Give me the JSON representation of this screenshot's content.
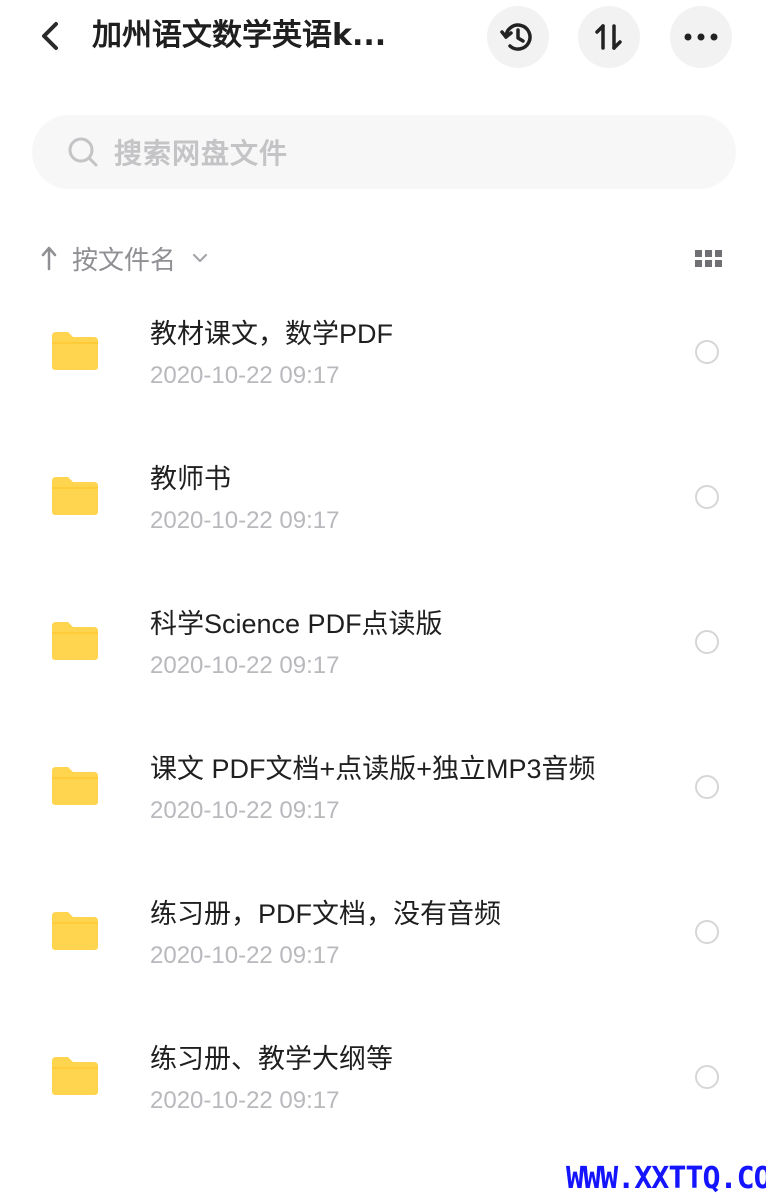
{
  "header": {
    "title": "加州语文数学英语k...",
    "back_icon": "chevron-left-icon",
    "history_icon": "history-icon",
    "sort_icon": "sort-arrows-icon",
    "more_icon": "more-dots-icon"
  },
  "search": {
    "placeholder": "搜索网盘文件",
    "icon": "search-icon"
  },
  "sort": {
    "label": "按文件名",
    "direction_icon": "arrow-up-icon",
    "dropdown_icon": "chevron-down-icon",
    "view_icon": "grid-view-icon"
  },
  "files": [
    {
      "name": "教材课文，数学PDF",
      "date": "2020-10-22  09:17",
      "icon": "folder-icon"
    },
    {
      "name": "教师书",
      "date": "2020-10-22  09:17",
      "icon": "folder-icon"
    },
    {
      "name": "科学Science PDF点读版",
      "date": "2020-10-22  09:17",
      "icon": "folder-icon"
    },
    {
      "name": "课文 PDF文档+点读版+独立MP3音频",
      "date": "2020-10-22  09:17",
      "icon": "folder-icon"
    },
    {
      "name": "练习册，PDF文档，没有音频",
      "date": "2020-10-22  09:17",
      "icon": "folder-icon"
    },
    {
      "name": "练习册、教学大纲等",
      "date": "2020-10-22  09:17",
      "icon": "folder-icon"
    }
  ],
  "watermark": "WWW.XXTTQ.COM",
  "colors": {
    "folder": "#ffd54f",
    "text_primary": "#1f1f1f",
    "text_secondary": "#b9b9bd",
    "watermark": "#1414ff"
  }
}
